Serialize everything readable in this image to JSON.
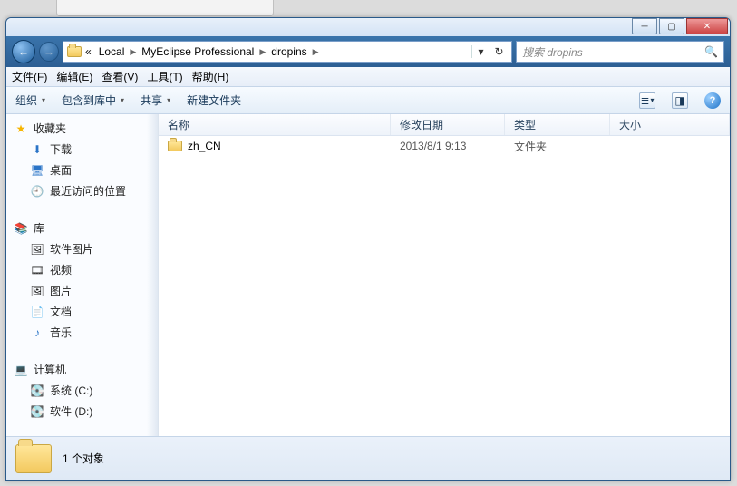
{
  "breadcrumb": {
    "prefix": "«",
    "items": [
      "Local",
      "MyEclipse Professional",
      "dropins"
    ]
  },
  "search": {
    "placeholder": "搜索 dropins"
  },
  "menu": {
    "file": "文件(F)",
    "edit": "编辑(E)",
    "view": "查看(V)",
    "tools": "工具(T)",
    "help": "帮助(H)"
  },
  "toolbar": {
    "organize": "组织",
    "include": "包含到库中",
    "share": "共享",
    "newfolder": "新建文件夹"
  },
  "sidebar": {
    "favorites": {
      "title": "收藏夹",
      "items": [
        "下载",
        "桌面",
        "最近访问的位置"
      ]
    },
    "libraries": {
      "title": "库",
      "items": [
        "软件图片",
        "视频",
        "图片",
        "文档",
        "音乐"
      ]
    },
    "computer": {
      "title": "计算机",
      "items": [
        "系统 (C:)",
        "软件 (D:)"
      ]
    }
  },
  "columns": {
    "name": "名称",
    "date": "修改日期",
    "type": "类型",
    "size": "大小"
  },
  "files": [
    {
      "name": "zh_CN",
      "date": "2013/8/1 9:13",
      "type": "文件夹",
      "size": ""
    }
  ],
  "status": {
    "text": "1 个对象"
  }
}
